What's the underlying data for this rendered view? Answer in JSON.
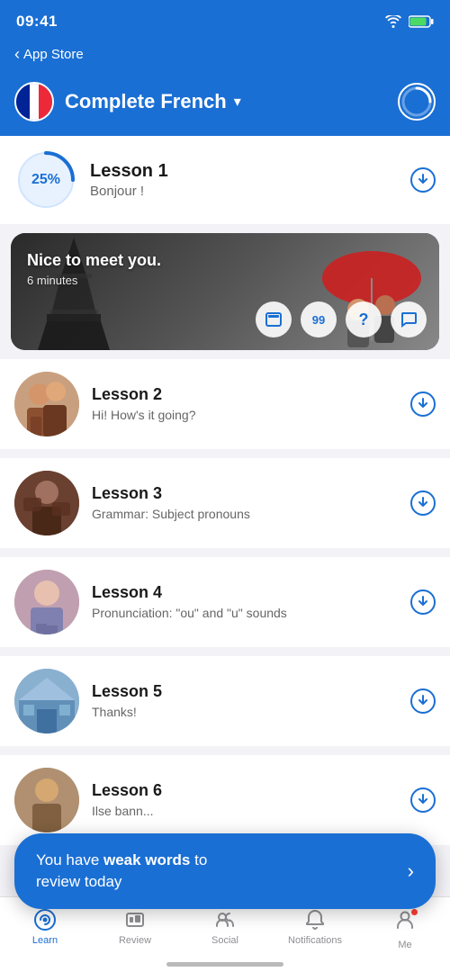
{
  "statusBar": {
    "time": "09:41",
    "back": "App Store"
  },
  "header": {
    "courseName": "Complete French",
    "flagColors": [
      "#002395",
      "#FFFFFF",
      "#ED2939"
    ]
  },
  "lesson1": {
    "progress": "25%",
    "title": "Lesson 1",
    "subtitle": "Bonjour !"
  },
  "featuredCard": {
    "title": "Nice to meet you.",
    "duration": "6 minutes"
  },
  "lessons": [
    {
      "number": 2,
      "title": "Lesson 2",
      "subtitle": "Hi! How's it going?",
      "thumbClass": "thumb-people1"
    },
    {
      "number": 3,
      "title": "Lesson 3",
      "subtitle": "Grammar: Subject pronouns",
      "thumbClass": "thumb-people2"
    },
    {
      "number": 4,
      "title": "Lesson 4",
      "subtitle": "Pronunciation: \"ou\" and \"u\" sounds",
      "thumbClass": "thumb-people3"
    },
    {
      "number": 5,
      "title": "Lesson 5",
      "subtitle": "Thanks!",
      "thumbClass": "thumb-building"
    },
    {
      "number": 6,
      "title": "Lesson 6",
      "subtitle": "Ilse bann...",
      "thumbClass": "thumb-people4"
    }
  ],
  "weakWordsBanner": {
    "text1": "You have ",
    "bold": "weak words",
    "text2": " to review today"
  },
  "tabBar": {
    "tabs": [
      {
        "id": "learn",
        "label": "Learn",
        "active": true
      },
      {
        "id": "review",
        "label": "Review",
        "active": false
      },
      {
        "id": "social",
        "label": "Social",
        "active": false
      },
      {
        "id": "notifications",
        "label": "Notifications",
        "active": false
      },
      {
        "id": "me",
        "label": "Me",
        "active": false
      }
    ]
  }
}
